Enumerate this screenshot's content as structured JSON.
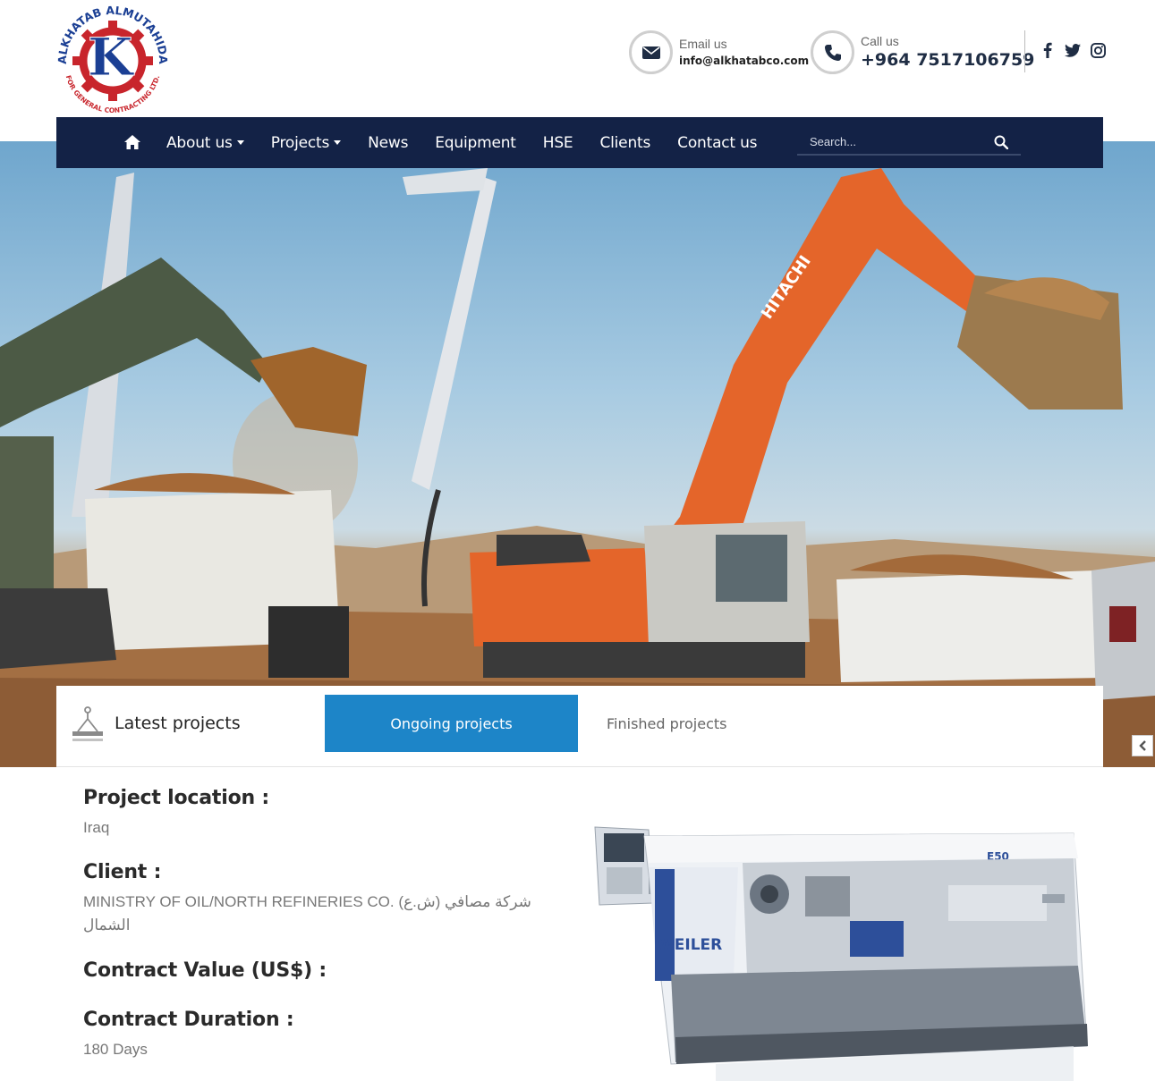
{
  "header": {
    "logo": {
      "arc_text": "ALKHATAB ALMUTAHIDA",
      "bottom_text": "FOR GENERAL CONTRACTING LTD.",
      "letter": "K"
    },
    "email": {
      "label": "Email us",
      "value": "info@alkhatabco.com",
      "icon": "envelope-icon"
    },
    "phone": {
      "label": "Call us",
      "value": "+964 7517106759",
      "icon": "phone-icon"
    },
    "social": [
      "facebook-icon",
      "twitter-icon",
      "instagram-icon"
    ]
  },
  "nav": {
    "home_icon": "home-icon",
    "items": [
      {
        "label": "About us",
        "dropdown": true
      },
      {
        "label": "Projects",
        "dropdown": true
      },
      {
        "label": "News",
        "dropdown": false
      },
      {
        "label": "Equipment",
        "dropdown": false
      },
      {
        "label": "HSE",
        "dropdown": false
      },
      {
        "label": "Clients",
        "dropdown": false
      },
      {
        "label": "Contact us",
        "dropdown": false
      }
    ],
    "search": {
      "placeholder": "Search..."
    }
  },
  "hero": {
    "brand_on_machine": "HITACHI"
  },
  "tabs": {
    "title": "Latest projects",
    "items": [
      {
        "label": "Ongoing projects",
        "active": true
      },
      {
        "label": "Finished projects",
        "active": false
      }
    ]
  },
  "project": {
    "location_label": "Project location :",
    "location": "Iraq",
    "client_label": "Client :",
    "client": "MINISTRY OF OIL/NORTH REFINERIES CO. (ش.ع) شركة مصافي الشمال",
    "value_label": "Contract Value (US$) :",
    "duration_label": "Contract Duration :",
    "duration": "180 Days",
    "image_brand": "WEILER",
    "image_model": "E50"
  },
  "colors": {
    "nav_bg": "#132246",
    "active_tab": "#1d85c8",
    "logo_blue": "#1b3f94",
    "logo_red": "#c8252c"
  }
}
